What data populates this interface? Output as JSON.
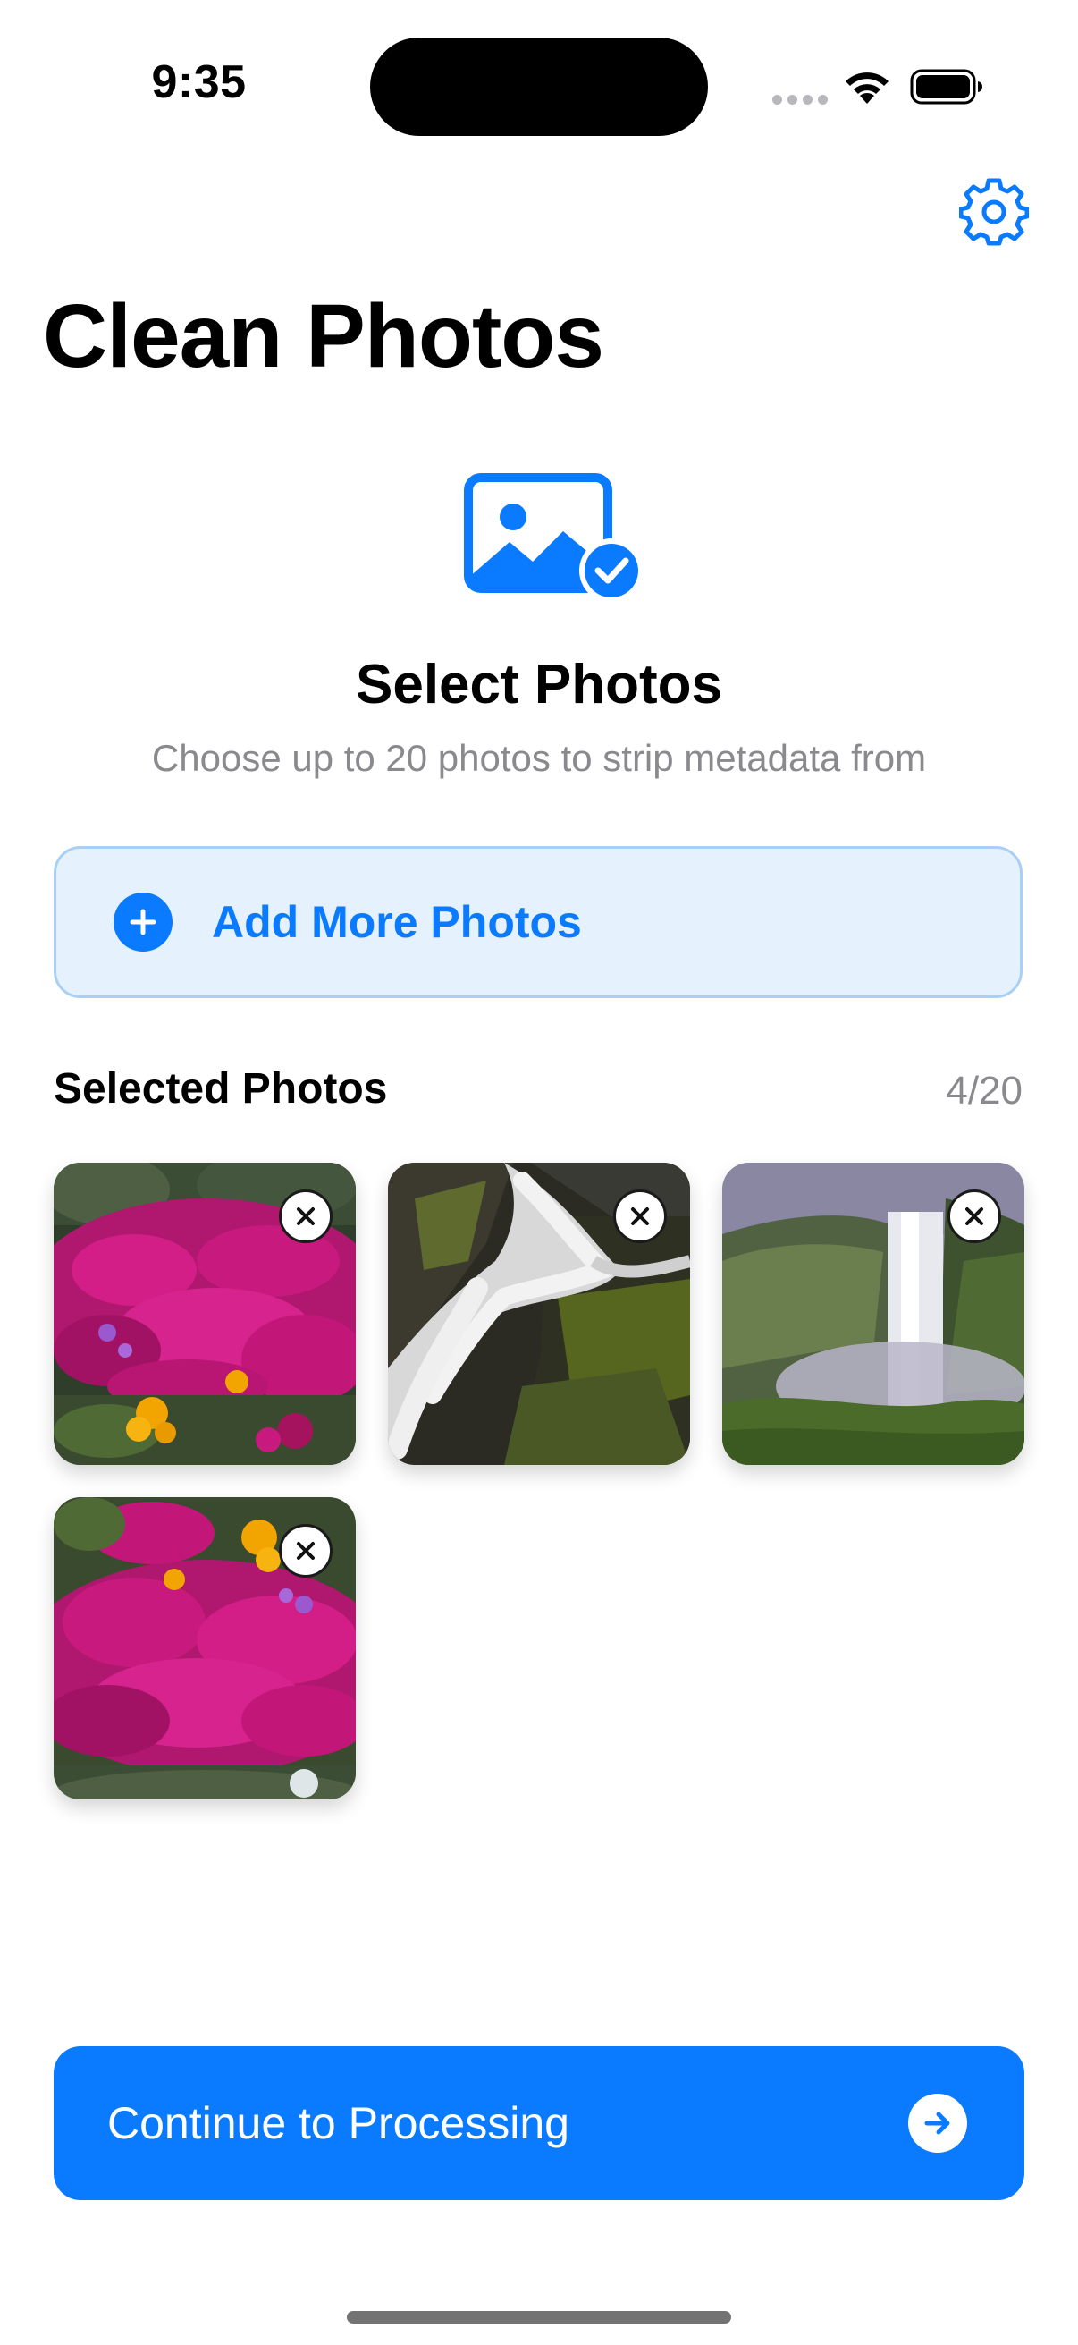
{
  "status_bar": {
    "time": "9:35"
  },
  "header": {
    "title": "Clean Photos",
    "settings_icon": "gear-icon"
  },
  "hero": {
    "icon": "photo-badge-checkmark-icon",
    "title": "Select Photos",
    "subtitle": "Choose up to 20 photos to strip metadata from"
  },
  "add_button": {
    "label": "Add More Photos",
    "icon": "plus-circle-icon"
  },
  "selected": {
    "heading": "Selected Photos",
    "count": "4/20",
    "photos": [
      {
        "subject": "pink flowers",
        "remove_icon": "close-icon"
      },
      {
        "subject": "waterfall over mossy rocks",
        "remove_icon": "close-icon"
      },
      {
        "subject": "waterfall in green valley",
        "remove_icon": "close-icon"
      },
      {
        "subject": "pink flowers (rotated)",
        "remove_icon": "close-icon"
      }
    ]
  },
  "continue_button": {
    "label": "Continue to Processing",
    "icon": "arrow-right-circle-icon"
  },
  "colors": {
    "accent": "#0A7AFF",
    "add_button_bg": "#E5F1FC",
    "add_button_border": "#A9D0F4",
    "secondary_text": "#8A8A8E"
  }
}
